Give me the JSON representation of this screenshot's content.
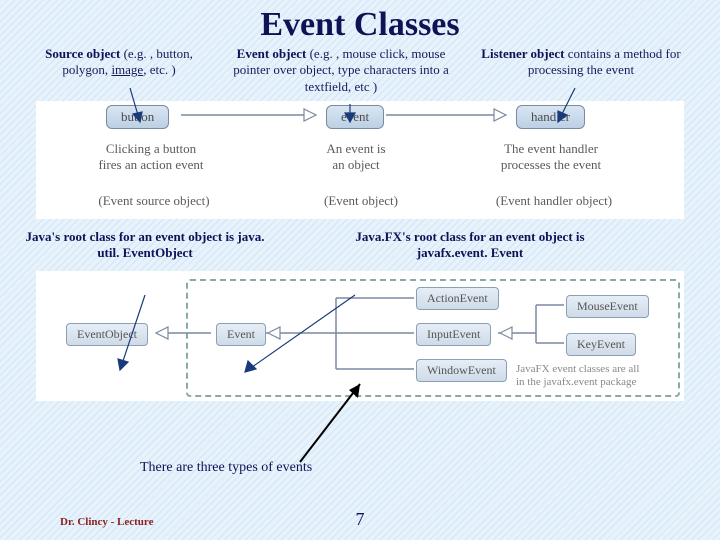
{
  "title": "Event Classes",
  "top": {
    "source": {
      "bold": "Source object",
      "rest": " (e.g. , button, polygon, ",
      "uline": "image",
      "rest2": ", etc. )"
    },
    "event": {
      "bold": "Event object",
      "rest": " (e.g. , mouse click, mouse pointer over object, type characters into a textfield, etc )"
    },
    "listener": {
      "bold": "Listener object",
      "rest": " contains a method for processing the event"
    }
  },
  "fig1": {
    "n1": "button",
    "n2": "event",
    "n3": "handler",
    "c1a": "Clicking a button",
    "c1b": "fires an action event",
    "c2a": "An event is",
    "c2b": "an object",
    "c3a": "The event handler",
    "c3b": "processes the event",
    "p1": "(Event source object)",
    "p2": "(Event object)",
    "p3": "(Event handler object)"
  },
  "mid": {
    "left": "Java's root class for an event object is java. util. EventObject",
    "right": "Java.FX's root class for an event object is javafx.event. Event"
  },
  "fig2": {
    "eo": "EventObject",
    "ev": "Event",
    "ae": "ActionEvent",
    "ie": "InputEvent",
    "we": "WindowEvent",
    "me": "MouseEvent",
    "ke": "KeyEvent",
    "pkg1": "JavaFX event classes are all",
    "pkg2": "in the javafx.event package"
  },
  "three": "There are three types of events",
  "footerLeft": "Dr. Clincy - Lecture",
  "pageNum": "7"
}
